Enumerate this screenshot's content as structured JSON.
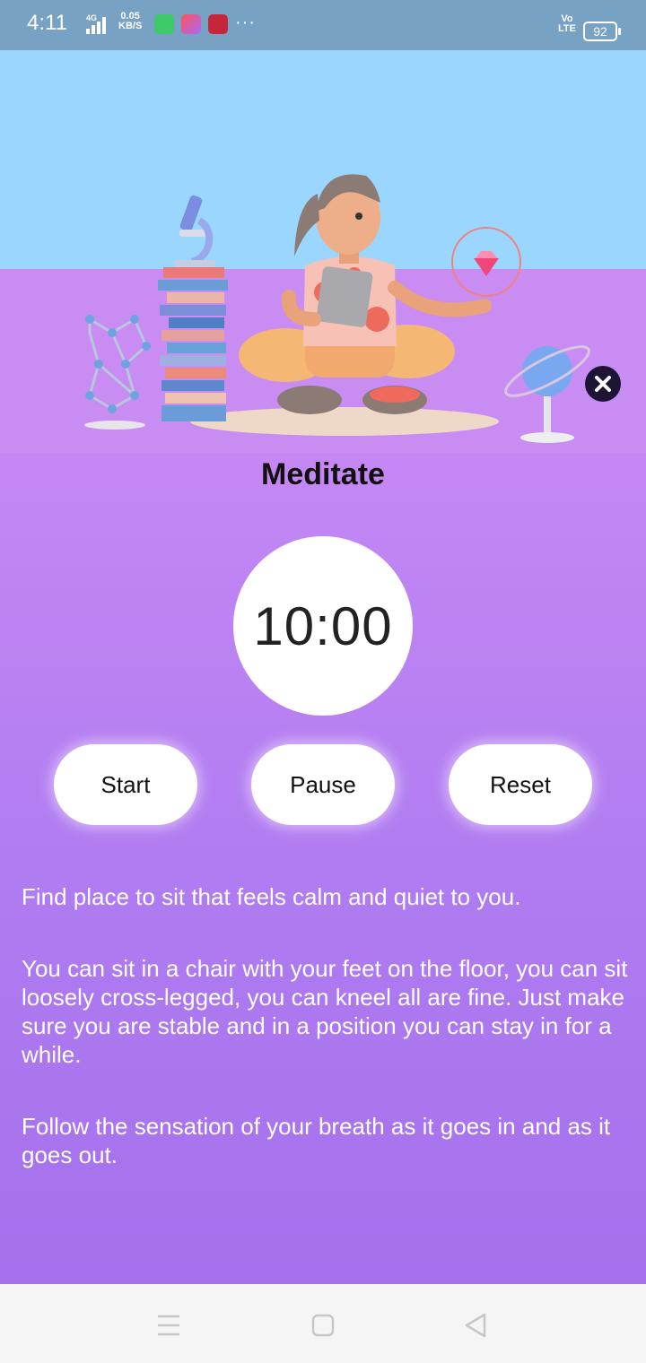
{
  "status_bar": {
    "time": "4:11",
    "network": "4G",
    "speed_value": "0.05",
    "speed_unit": "KB/S",
    "more": "···",
    "volte_top": "Vo",
    "volte_bottom": "LTE",
    "battery": "92"
  },
  "screen": {
    "title": "Meditate",
    "timer": "10:00",
    "buttons": {
      "start": "Start",
      "pause": "Pause",
      "reset": "Reset"
    },
    "instructions": [
      "Find place to sit that feels calm and quiet to you.",
      "You can sit in a chair with your feet on the floor, you can sit loosely cross-legged, you can kneel all are fine. Just make sure you are stable and in a position you can stay in for a while.",
      "Follow the sensation of your breath as it goes in and as it goes out."
    ]
  },
  "icons": {
    "close": "close-icon",
    "nav_menu": "menu-icon",
    "nav_home": "home-icon",
    "nav_back": "back-icon"
  },
  "colors": {
    "status_bar": "#77a2c3",
    "sky": "#9ad6fd",
    "floor": "#c98cf3",
    "panel_top": "#c587f4",
    "panel_bottom": "#a571ec",
    "close_button": "#1e1535"
  }
}
